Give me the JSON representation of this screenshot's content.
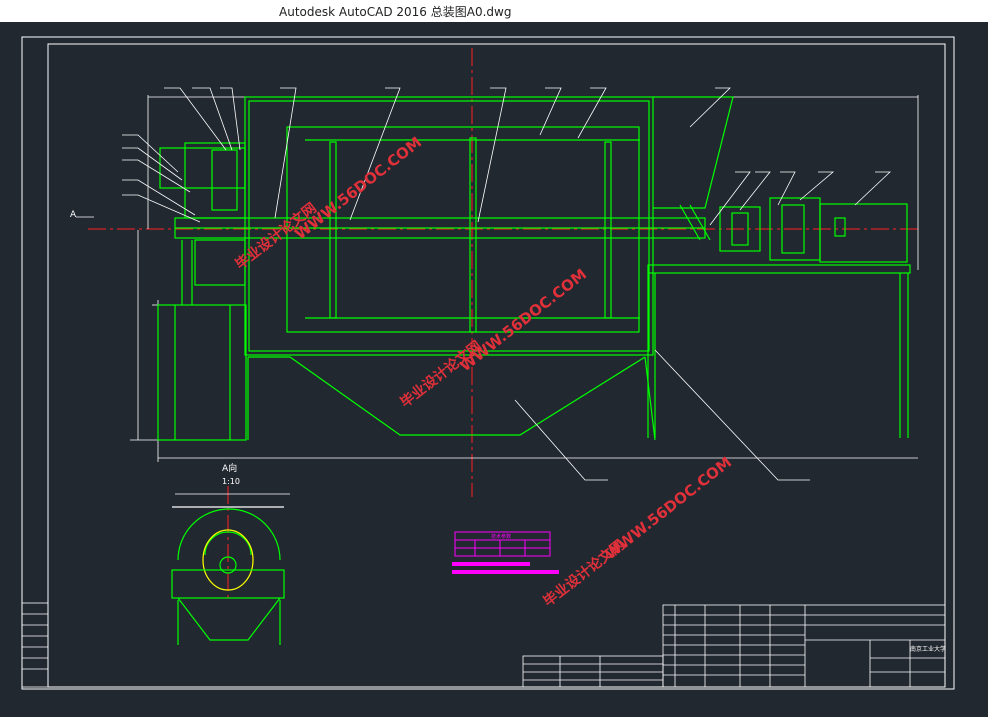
{
  "window": {
    "title": "Autodesk AutoCAD 2016     总装图A0.dwg"
  },
  "drawing": {
    "view_label": "A",
    "section_title": "A向",
    "section_scale": "1:10",
    "table_title": "技术参数",
    "watermark_url": "WWW.56DOC.COM",
    "watermark_cn": "毕业设计论文网",
    "university": "南京工业大学",
    "colors": {
      "background": "#212830",
      "frame": "#ffffff",
      "geometry": "#00ff00",
      "centerline": "#ff2020",
      "dimension": "#ffffff",
      "table": "#ff00ff",
      "watermark": "#d9303a"
    }
  }
}
